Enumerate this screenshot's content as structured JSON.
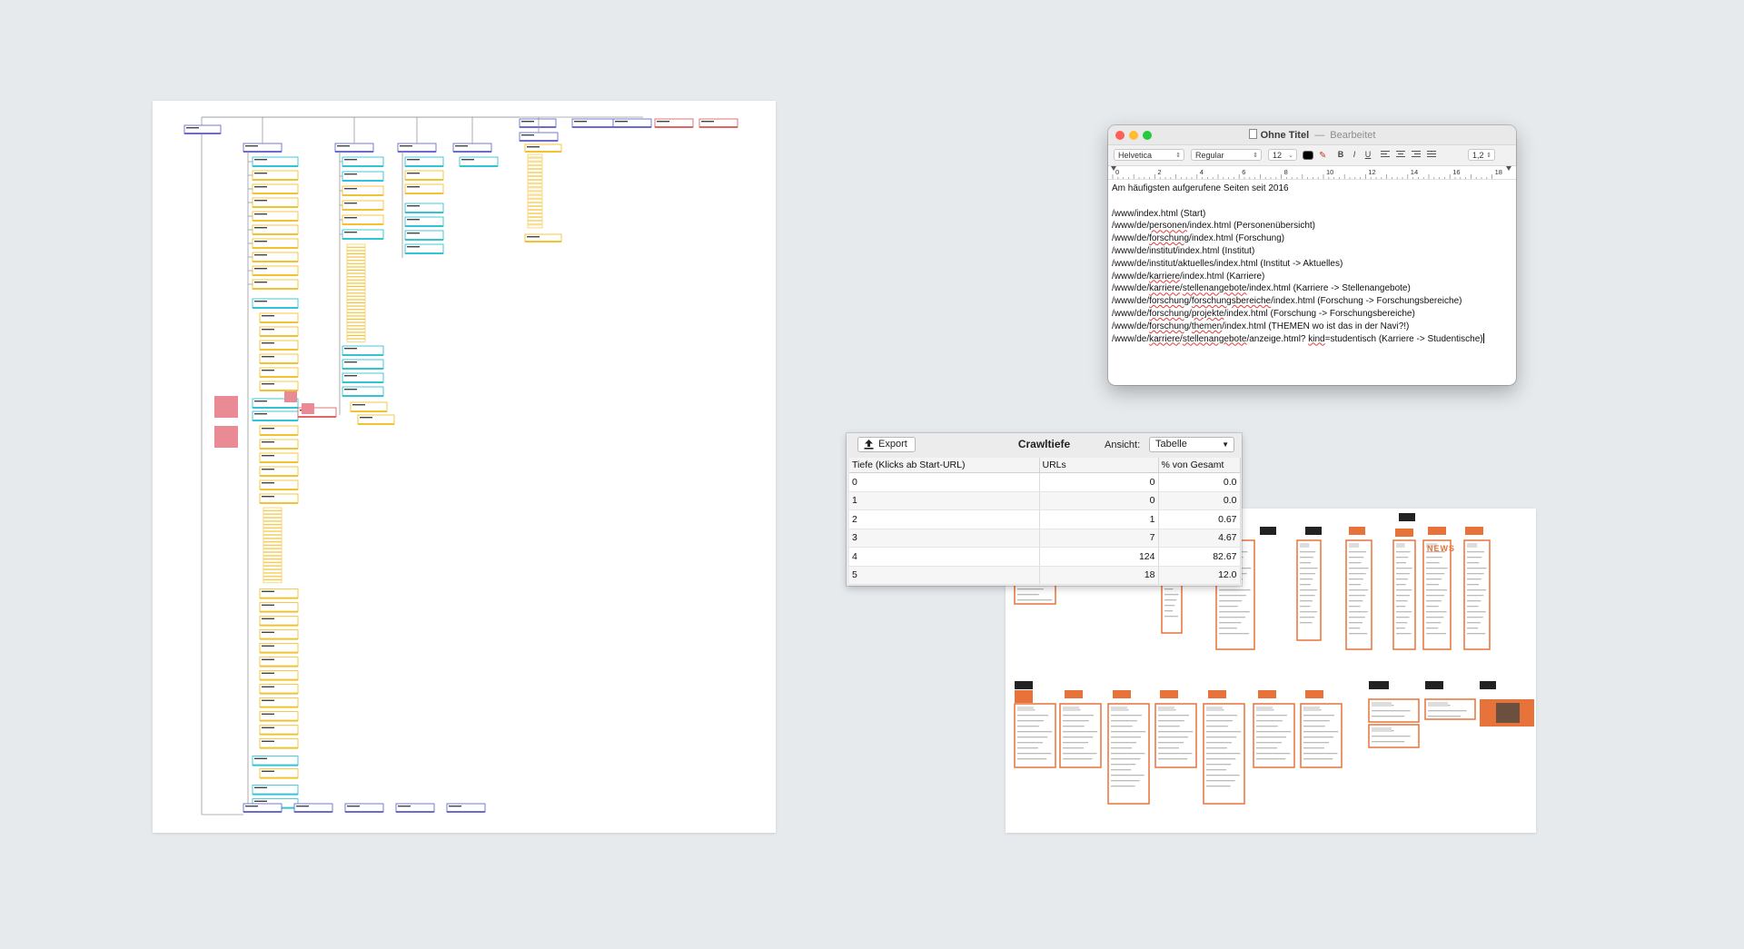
{
  "textedit": {
    "title": "Ohne Titel",
    "separator": "—",
    "status": "Bearbeitet",
    "font": "Helvetica",
    "style": "Regular",
    "size": "12",
    "spacing": "1,2",
    "bold": "B",
    "italic": "I",
    "underline": "U",
    "ruler_marks": [
      "0",
      "2",
      "4",
      "6",
      "8",
      "10",
      "12",
      "14",
      "16",
      "18"
    ],
    "lines": [
      "Am häufigsten aufgerufene Seiten seit 2016",
      "",
      "/www/index.html (Start)",
      "/www/de/personen/index.html (Personenübersicht)",
      "/www/de/forschung/index.html (Forschung)",
      "/www/de/institut/index.html (Institut)",
      "/www/de/institut/aktuelles/index.html (Institut -> Aktuelles)",
      "/www/de/karriere/index.html (Karriere)",
      "/www/de/karriere/stellenangebote/index.html (Karriere -> Stellenangebote)",
      "/www/de/forschung/forschungsbereiche/index.html (Forschung -> Forschungsbereiche)",
      "/www/de/forschung/projekte/index.html (Forschung -> Forschungsbereiche)",
      "/www/de/forschung/themen/index.html (THEMEN wo ist das in der Navi?!)",
      "/www/de/karriere/stellenangebote/anzeige.html? kind=studentisch (Karriere -> Studentische)"
    ]
  },
  "crawl": {
    "export_label": "Export",
    "title": "Crawltiefe",
    "view_label": "Ansicht:",
    "view_value": "Tabelle",
    "columns": [
      "Tiefe (Klicks ab Start-URL)",
      "URLs",
      "% von Gesamt"
    ],
    "rows": [
      {
        "depth": "0",
        "urls": "0",
        "pct": "0.0"
      },
      {
        "depth": "1",
        "urls": "0",
        "pct": "0.0"
      },
      {
        "depth": "2",
        "urls": "1",
        "pct": "0.67"
      },
      {
        "depth": "3",
        "urls": "7",
        "pct": "4.67"
      },
      {
        "depth": "4",
        "urls": "124",
        "pct": "82.67"
      },
      {
        "depth": "5",
        "urls": "18",
        "pct": "12.0"
      }
    ]
  },
  "storyboard": {
    "news_text": "NEWS"
  },
  "colors": {
    "node_purple": "#6c6ccf",
    "node_yellow": "#f2c230",
    "node_cyan": "#33c3d6",
    "node_red": "#e06666",
    "sticky_pink": "#e98a95",
    "storyboard_orange": "#e8733a",
    "sticky_yellow": "#fbf3a1"
  }
}
